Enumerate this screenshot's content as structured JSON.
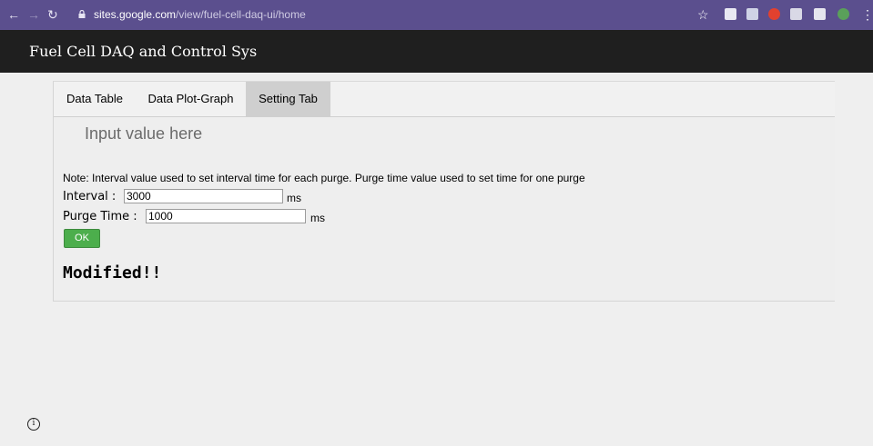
{
  "browser": {
    "url_host": "sites.google.com",
    "url_path": "/view/fuel-cell-daq-ui/home",
    "icons": [
      "back-arrow-icon",
      "forward-arrow-icon",
      "reload-icon",
      "lock-icon",
      "star-icon",
      "extensions-icon",
      "menu-dots-icon"
    ]
  },
  "site": {
    "title": "Fuel Cell DAQ and Control Sys"
  },
  "tabs": [
    {
      "label": "Data Table"
    },
    {
      "label": "Data Plot-Graph"
    },
    {
      "label": "Setting Tab",
      "active": true
    }
  ],
  "settings": {
    "heading": "Input value here",
    "note": "Note: Interval value used to set interval time for each purge. Purge time value used to set time for one purge",
    "interval": {
      "label": "Interval :",
      "value": "3000",
      "unit": "ms"
    },
    "purge": {
      "label": "Purge Time :",
      "value": "1000",
      "unit": "ms"
    },
    "ok_label": "OK",
    "status": "Modified!!"
  },
  "colors": {
    "browser_bar": "#5b4f8e",
    "site_bar": "#1f1f1f",
    "ok_button": "#4cae4c",
    "active_tab": "#cfcfcf"
  }
}
